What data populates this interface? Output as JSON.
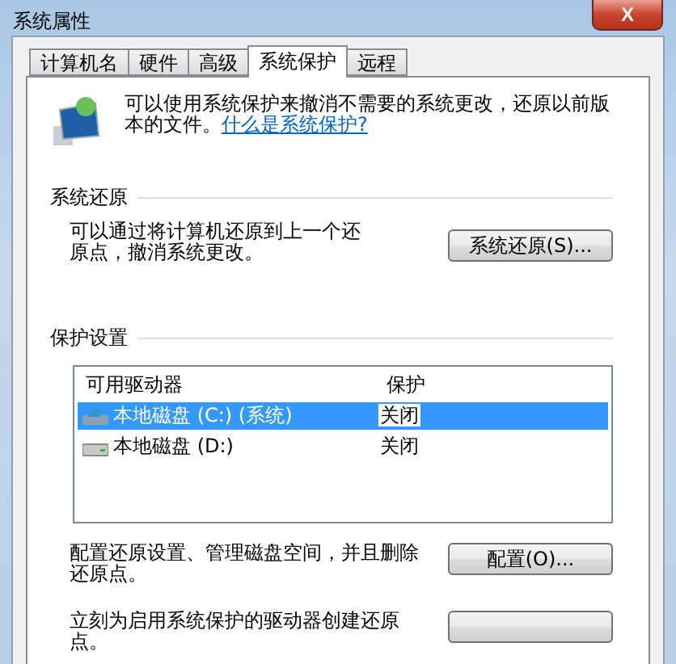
{
  "window": {
    "title": "系统属性",
    "close": "X"
  },
  "tabs": [
    {
      "label": "计算机名",
      "selected": false
    },
    {
      "label": "硬件",
      "selected": false
    },
    {
      "label": "高级",
      "selected": false
    },
    {
      "label": "系统保护",
      "selected": true
    },
    {
      "label": "远程",
      "selected": false
    }
  ],
  "intro": {
    "text": "可以使用系统保护来撤消不需要的系统更改，还原以前版本的文件。",
    "link": "什么是系统保护?"
  },
  "restore": {
    "heading": "系统还原",
    "text": "可以通过将计算机还原到上一个还原点，撤消系统更改。",
    "button": "系统还原(S)..."
  },
  "protection": {
    "heading": "保护设置",
    "columns": [
      "可用驱动器",
      "保护"
    ],
    "rows": [
      {
        "drive": "本地磁盘 (C:) (系统)",
        "kind": "system",
        "protection": "关闭",
        "selected": true
      },
      {
        "drive": "本地磁盘 (D:)",
        "kind": "disk",
        "protection": "关闭",
        "selected": false
      }
    ],
    "configure_text": "配置还原设置、管理磁盘空间，并且删除还原点。",
    "configure_button": "配置(O)...",
    "create_text": "立刻为启用系统保护的驱动器创建还原点。"
  }
}
